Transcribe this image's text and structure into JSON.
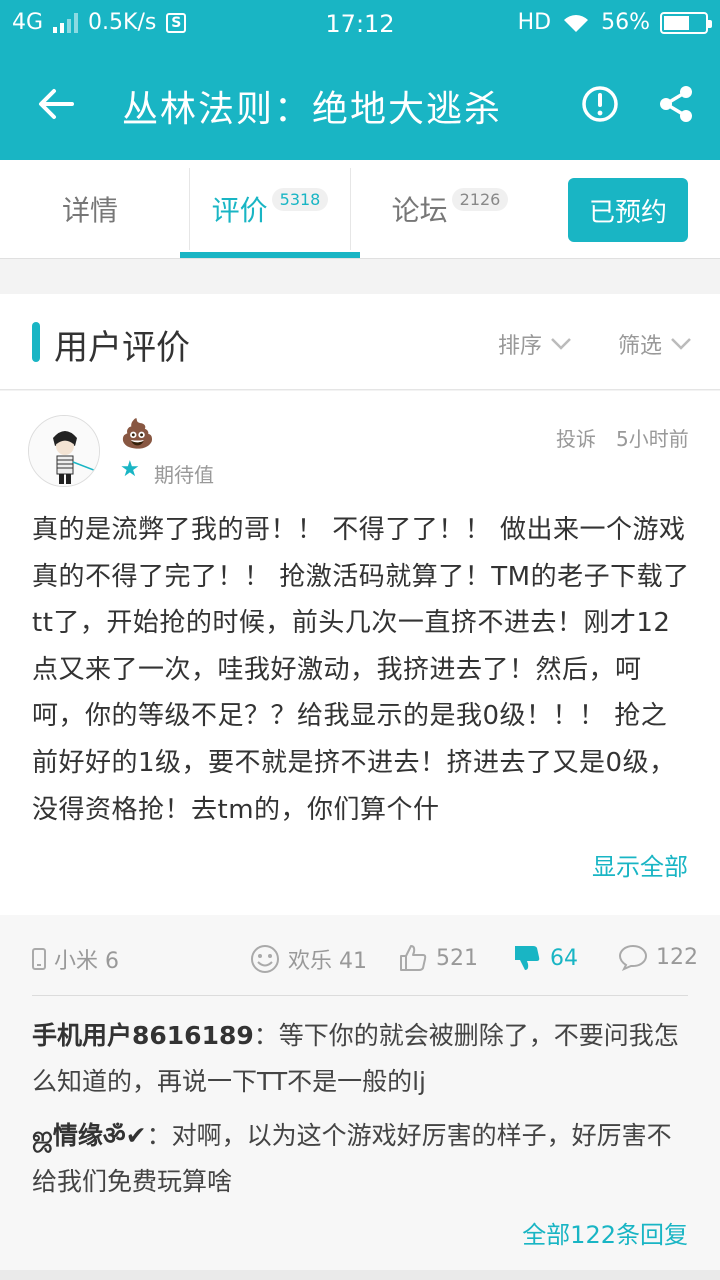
{
  "status_bar": {
    "network": "4G",
    "speed": "0.5K/s",
    "s_icon": "S",
    "time": "17:12",
    "hd": "HD",
    "battery": "56%",
    "battery_level": 0.56
  },
  "app_bar": {
    "title": "丛林法则：绝地大逃杀"
  },
  "tabs": [
    {
      "label": "详情",
      "badge": ""
    },
    {
      "label": "评价",
      "badge": "5318"
    },
    {
      "label": "论坛",
      "badge": "2126"
    }
  ],
  "reserve_button": "已预约",
  "section": {
    "title": "用户评价",
    "sort": "排序",
    "filter": "筛选"
  },
  "review": {
    "user_icon": "poop-emoji",
    "user_emoji": "💩",
    "expect_label": "期待值",
    "report": "投诉",
    "time": "5小时前",
    "text": "真的是流弊了我的哥！！ 不得了了！！ 做出来一个游戏真的不得了完了！！ 抢激活码就算了！TM的老子下载了tt了，开始抢的时候，前头几次一直挤不进去！刚才12点又来了一次，哇我好激动，我挤进去了！然后，呵呵，你的等级不足？？给我显示的是我0级！！！ 抢之前好好的1级，要不就是挤不进去！挤进去了又是0级，没得资格抢！去tm的，你们算个什",
    "show_all": "显示全部",
    "device": "小米 6",
    "happy": "欢乐 41",
    "likes": "521",
    "dislikes": "64",
    "comments": "122"
  },
  "replies": [
    {
      "user": "手机用户8616189",
      "text": "：等下你的就会被删除了，不要问我怎么知道的，再说一下TT不是一般的lj"
    },
    {
      "user": "ஜ情缘ॐ✔",
      "text": "：对啊，以为这个游戏好厉害的样子，好厉害不给我们免费玩算啥"
    }
  ],
  "all_replies": "全部122条回复",
  "colors": {
    "accent": "#19b5c4"
  }
}
